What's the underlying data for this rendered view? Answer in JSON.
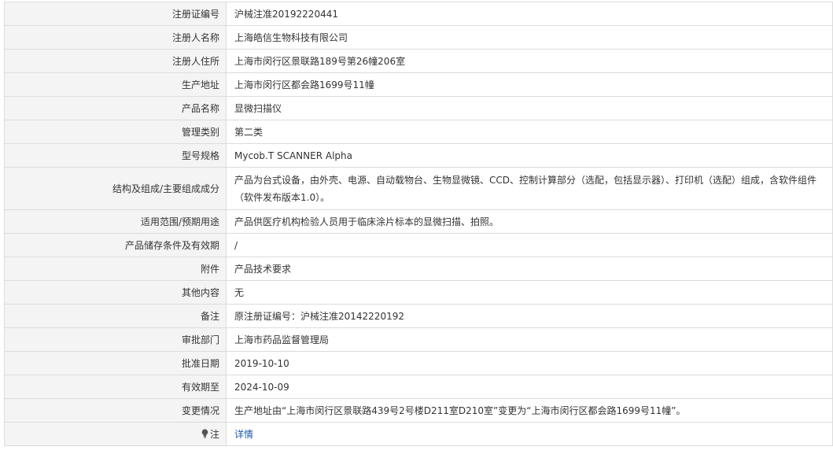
{
  "rows": [
    {
      "label": "注册证编号",
      "value": "沪械注准20192220441"
    },
    {
      "label": "注册人名称",
      "value": "上海皓信生物科技有限公司"
    },
    {
      "label": "注册人住所",
      "value": "上海市闵行区景联路189号第26幢206室"
    },
    {
      "label": "生产地址",
      "value": "上海市闵行区都会路1699号11幢"
    },
    {
      "label": "产品名称",
      "value": "显微扫描仪"
    },
    {
      "label": "管理类别",
      "value": "第二类"
    },
    {
      "label": "型号规格",
      "value": "Mycob.T SCANNER Alpha"
    },
    {
      "label": "结构及组成/主要组成成分",
      "value": "产品为台式设备，由外壳、电源、自动载物台、生物显微镜、CCD、控制计算部分（选配，包括显示器）、打印机（选配）组成，含软件组件（软件发布版本1.0）。"
    },
    {
      "label": "适用范围/预期用途",
      "value": "产品供医疗机构检验人员用于临床涂片标本的显微扫描、拍照。"
    },
    {
      "label": "产品储存条件及有效期",
      "value": "/"
    },
    {
      "label": "附件",
      "value": "产品技术要求"
    },
    {
      "label": "其他内容",
      "value": "无"
    },
    {
      "label": "备注",
      "value": "原注册证编号：沪械注准20142220192"
    },
    {
      "label": "审批部门",
      "value": "上海市药品监督管理局"
    },
    {
      "label": "批准日期",
      "value": "2019-10-10"
    },
    {
      "label": "有效期至",
      "value": "2024-10-09"
    },
    {
      "label": "变更情况",
      "value": "生产地址由“上海市闵行区景联路439号2号楼D211室D210室”变更为“上海市闵行区都会路1699号11幢”。"
    }
  ],
  "note": {
    "label": "注",
    "icon": "lightbulb-icon",
    "link_text": "详情"
  },
  "colors": {
    "label_bg": "#f4f4f4",
    "border": "#dcdcdc",
    "link": "#1a5aa8"
  }
}
